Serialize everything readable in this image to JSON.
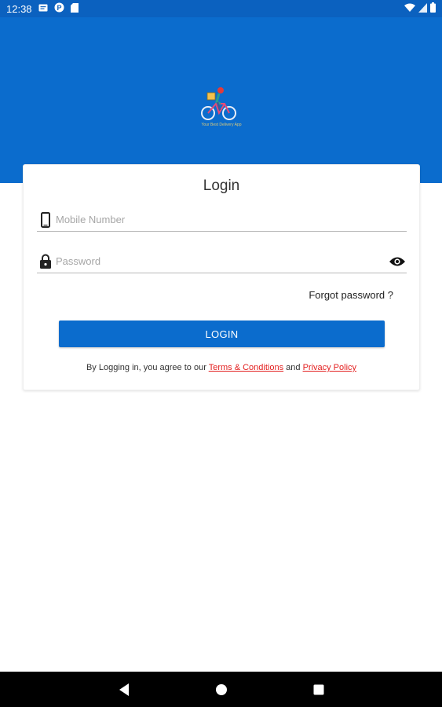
{
  "status_bar": {
    "time": "12:38",
    "left_icons": [
      "message-icon",
      "p-icon",
      "sd-card-icon"
    ],
    "right_icons": [
      "wifi-icon",
      "signal-icon",
      "battery-icon"
    ]
  },
  "header": {
    "logo_icon": "cyclist-logo-icon",
    "logo_caption": "Your Best Delivery App",
    "background": "#0b6ccd"
  },
  "login": {
    "title": "Login",
    "mobile_placeholder": "Mobile Number",
    "mobile_value": "",
    "password_placeholder": "Password",
    "password_value": "",
    "forgot_label": "Forgot password ?",
    "login_button": "LOGIN",
    "agree_prefix": "By Logging in, you agree to our ",
    "terms_label": "Terms & Conditions",
    "agree_and": " and ",
    "privacy_label": "Privacy Policy"
  },
  "nav_bar": {
    "buttons": [
      "back-icon",
      "home-icon",
      "recents-icon"
    ]
  },
  "colors": {
    "primary": "#0b6ccd",
    "link": "#e32020"
  }
}
